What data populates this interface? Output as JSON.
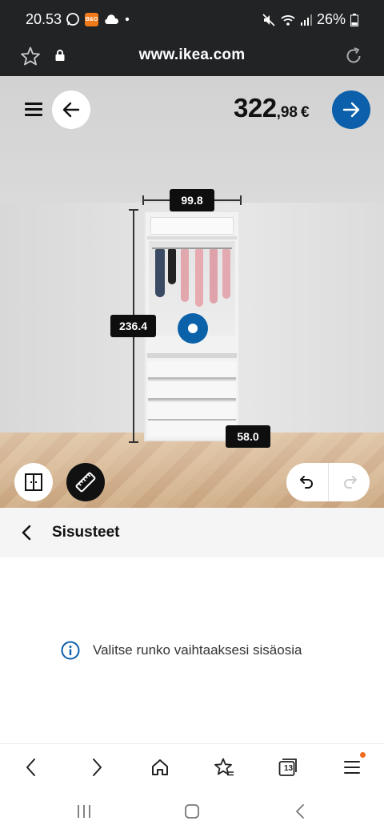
{
  "status_bar": {
    "time": "20.53",
    "battery": "26%",
    "icons": [
      "whatsapp-icon",
      "app-badge-icon",
      "cloud-icon",
      "dot-icon",
      "mute-icon",
      "wifi-icon",
      "signal-icon",
      "battery-icon"
    ],
    "app_badge_text": "B&O"
  },
  "url_bar": {
    "url": "www.ikea.com"
  },
  "planner": {
    "price_main": "322",
    "price_decimals": ",98",
    "currency": "€",
    "dimensions": {
      "width": "99.8",
      "height": "236.4",
      "depth": "58.0"
    }
  },
  "section": {
    "title": "Sisusteet"
  },
  "info": {
    "message": "Valitse runko vaihtaaksesi sisäosia"
  },
  "browser_nav": {
    "tabs_count": "13"
  },
  "colors": {
    "ikea_blue": "#0b5fab",
    "dark": "#111111",
    "status_bg": "#222325",
    "notification": "#f26b1d"
  }
}
